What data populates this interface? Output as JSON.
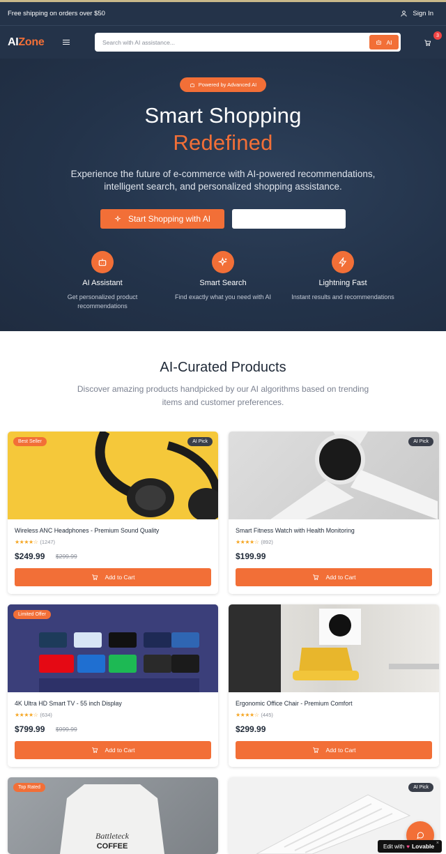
{
  "topbar": {
    "shipping": "Free shipping on orders over $50",
    "signin": "Sign In"
  },
  "nav": {
    "logo_prefix": "AI",
    "logo_suffix": "Zone",
    "search_placeholder": "Search with AI assistance...",
    "ai_button": "AI",
    "cart_count": "3"
  },
  "hero": {
    "badge": "Powered by Advanced AI",
    "title_line1": "Smart Shopping",
    "title_line2": "Redefined",
    "subtitle": "Experience the future of e-commerce with AI-powered recommendations, intelligent search, and personalized shopping assistance.",
    "primary_button": "Start Shopping with AI",
    "secondary_button": "",
    "features": [
      {
        "icon": "bot-icon",
        "title": "AI Assistant",
        "desc": "Get personalized product recommendations"
      },
      {
        "icon": "sparkles-icon",
        "title": "Smart Search",
        "desc": "Find exactly what you need with AI"
      },
      {
        "icon": "lightning-icon",
        "title": "Lightning Fast",
        "desc": "Instant results and recommendations"
      }
    ]
  },
  "products_section": {
    "title": "AI-Curated Products",
    "subtitle": "Discover amazing products handpicked by our AI algorithms based on trending items and customer preferences."
  },
  "products": [
    {
      "name": "Wireless ANC Headphones - Premium Sound Quality",
      "rating_count": "(1247)",
      "rating": 4,
      "price": "$249.99",
      "old_price": "$299.99",
      "tag_left": "Best Seller",
      "tag_right": "AI Pick",
      "button": "Add to Cart"
    },
    {
      "name": "Smart Fitness Watch with Health Monitoring",
      "rating_count": "(892)",
      "rating": 4,
      "price": "$199.99",
      "old_price": "",
      "tag_left": "",
      "tag_right": "AI Pick",
      "button": "Add to Cart"
    },
    {
      "name": "4K Ultra HD Smart TV - 55 inch Display",
      "rating_count": "(634)",
      "rating": 4,
      "price": "$799.99",
      "old_price": "$999.99",
      "tag_left": "Limited Offer",
      "tag_right": "",
      "button": "Add to Cart"
    },
    {
      "name": "Ergonomic Office Chair - Premium Comfort",
      "rating_count": "(445)",
      "rating": 4,
      "price": "$299.99",
      "old_price": "",
      "tag_left": "",
      "tag_right": "",
      "button": "Add to Cart"
    },
    {
      "tag_left": "Top Rated",
      "tag_right": "",
      "image_text_1": "Battleteck",
      "image_text_2": "COFFEE"
    },
    {
      "tag_left": "",
      "tag_right": "AI Pick"
    }
  ],
  "stars_text": "★★★★☆",
  "lovable": {
    "prefix": "Edit with",
    "brand": "Lovable",
    "close": "×"
  },
  "colors": {
    "accent": "#f26f37",
    "navy": "#243349"
  }
}
